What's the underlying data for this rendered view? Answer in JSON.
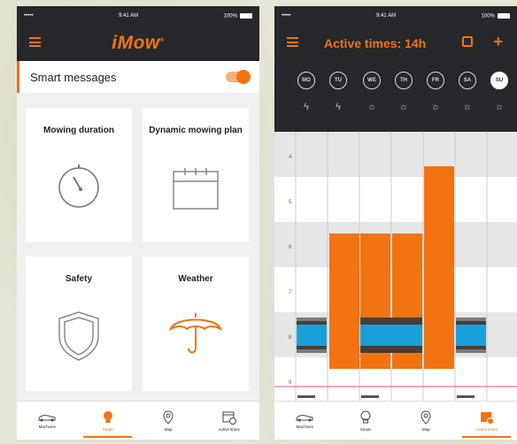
{
  "left": {
    "status": {
      "carrier": "••••• ",
      "time": "9:41 AM",
      "battery": "100%"
    },
    "logo": "iMow",
    "smart_messages": {
      "label": "Smart messages",
      "enabled": true
    },
    "tiles": [
      {
        "title": "Mowing duration",
        "icon": "stopwatch-icon"
      },
      {
        "title": "Dynamic mowing plan",
        "icon": "calendar-icon"
      },
      {
        "title": "Safety",
        "icon": "shield-icon"
      },
      {
        "title": "Weather",
        "icon": "umbrella-icon"
      }
    ],
    "tabs": [
      {
        "label": "Machines",
        "icon": "mower-icon"
      },
      {
        "label": "Smart",
        "icon": "lightbulb-icon",
        "active": true
      },
      {
        "label": "Map",
        "icon": "map-pin-icon"
      },
      {
        "label": "Active times",
        "icon": "calendar-clock-icon"
      }
    ]
  },
  "right": {
    "status": {
      "carrier": "••••• ",
      "time": "9:41 AM",
      "battery": "100%"
    },
    "title": "Active times: 14h",
    "days": [
      "MO",
      "TU",
      "WE",
      "TH",
      "FR",
      "SA",
      "SU"
    ],
    "active_day": "SU",
    "weather": [
      "lightning",
      "lightning",
      "sun",
      "sun",
      "sun",
      "sun",
      "sun"
    ],
    "hours": [
      "4",
      "5",
      "6",
      "7",
      "8",
      "9"
    ],
    "tabs": [
      {
        "label": "Machines",
        "icon": "mower-icon"
      },
      {
        "label": "Smart",
        "icon": "lightbulb-icon"
      },
      {
        "label": "Map",
        "icon": "map-pin-icon"
      },
      {
        "label": "Active times",
        "icon": "calendar-clock-icon",
        "active": true
      }
    ]
  },
  "colors": {
    "accent": "#f27312",
    "dark": "#26282b",
    "blue": "#1a9fd9"
  }
}
